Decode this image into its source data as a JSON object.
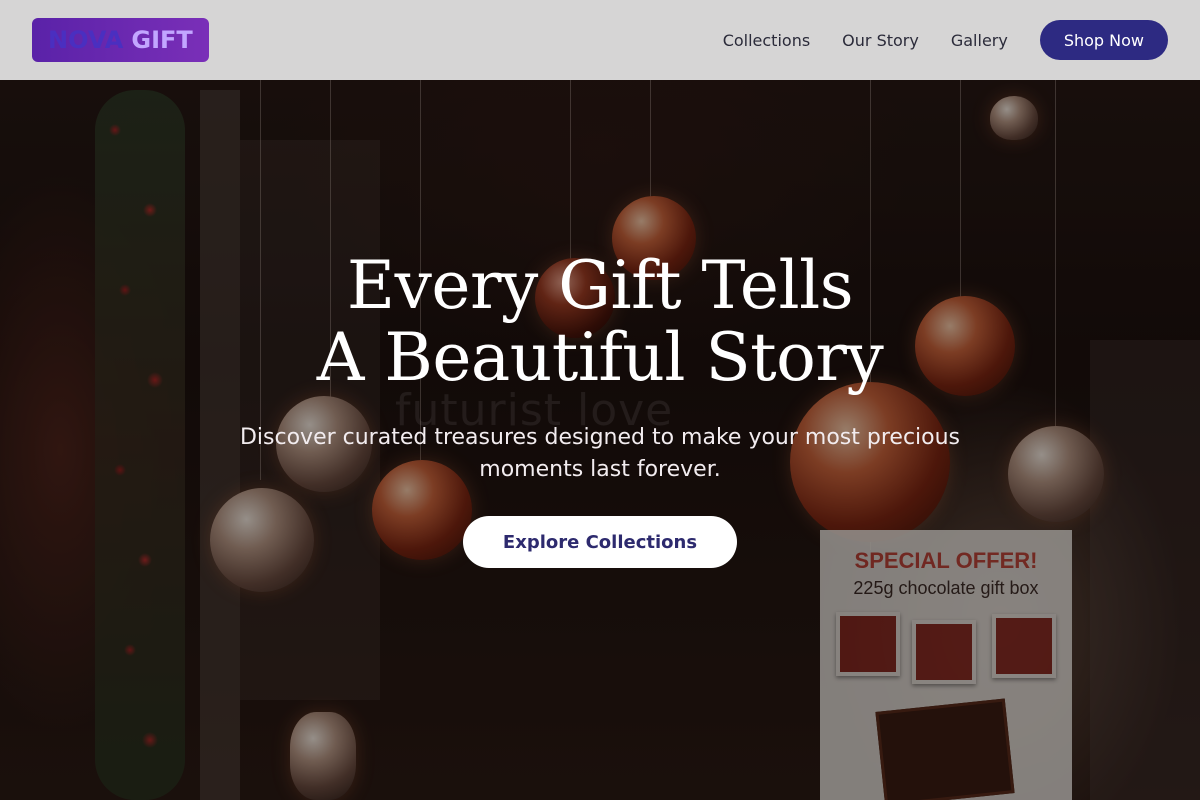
{
  "brand": {
    "word_1": "NOVA",
    "word_2": "GIFT"
  },
  "nav": {
    "links": [
      "Collections",
      "Our Story",
      "Gallery"
    ],
    "cta_label": "Shop Now"
  },
  "hero": {
    "title_line_1": "Every Gift Tells",
    "title_line_2": "A Beautiful Story",
    "subtitle_line_1": "Discover curated treasures designed to make your most precious",
    "subtitle_line_2": "moments last forever.",
    "cta_label": "Explore Collections"
  },
  "background_photo": {
    "window_decal": "futurist love",
    "sign_title": "SPECIAL OFFER!",
    "sign_subtitle": "225g chocolate gift box"
  },
  "colors": {
    "header_bg": "#dedede",
    "brand_gradient_start": "#5a22a8",
    "brand_gradient_end": "#7a2fb8",
    "primary_button": "#2d2a82",
    "cta_text": "#2d2a6e"
  }
}
